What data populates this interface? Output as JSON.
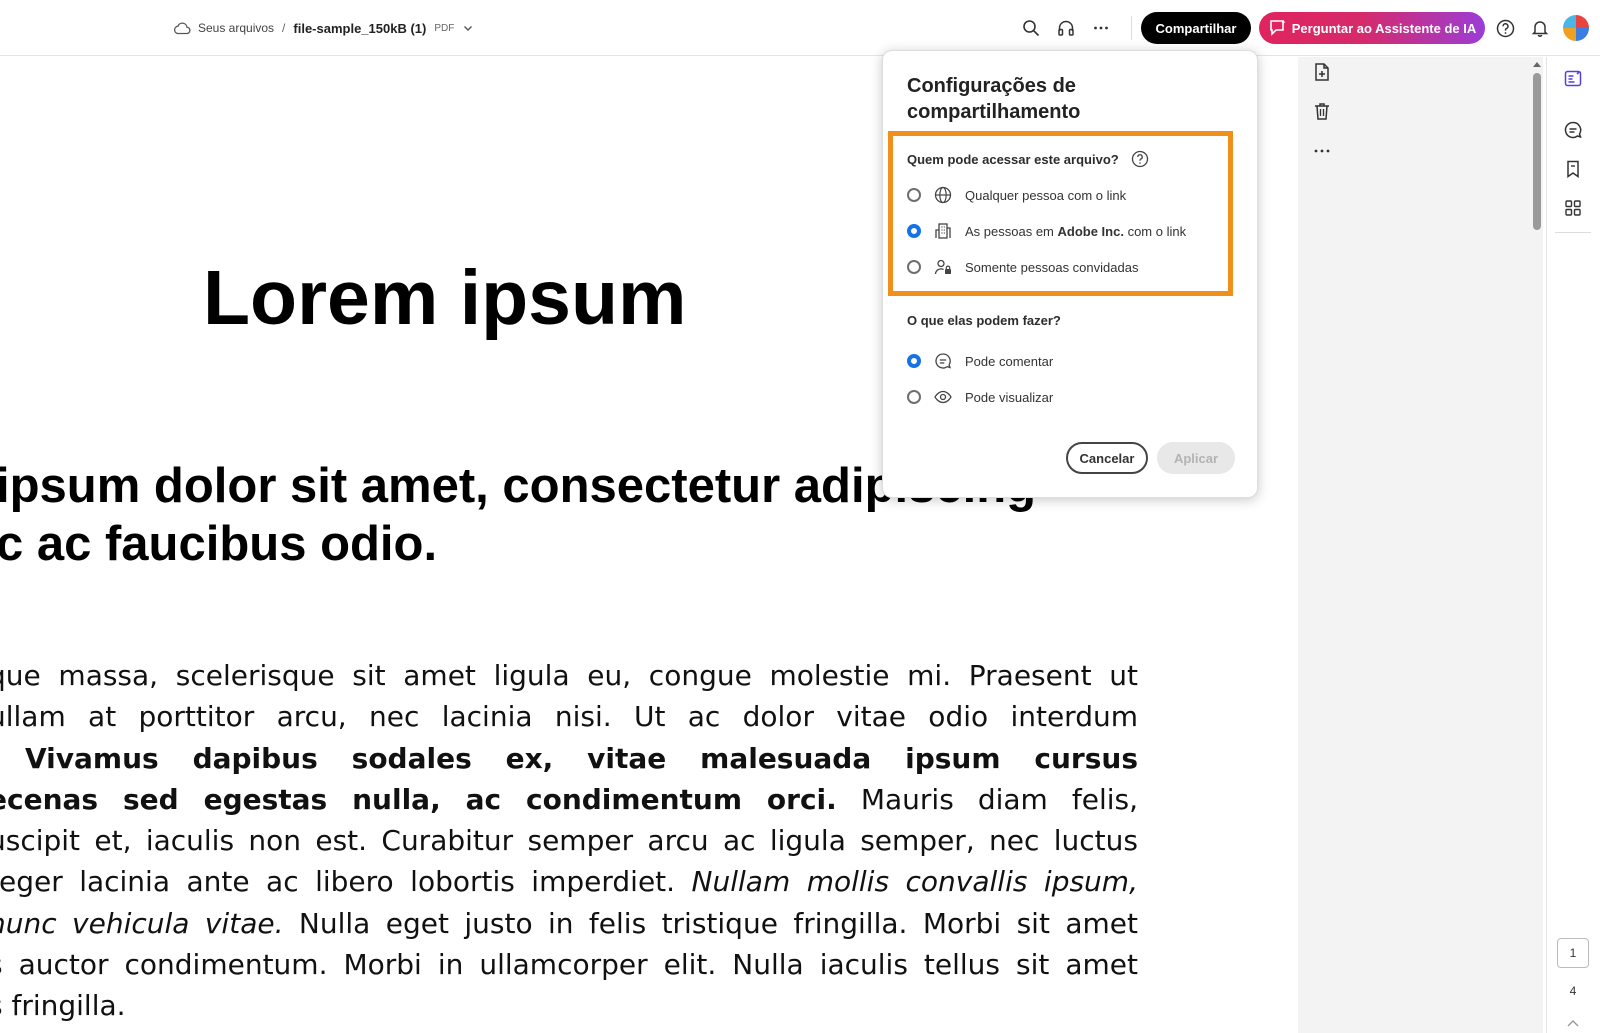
{
  "header": {
    "breadcrumb_root": "Seus arquivos",
    "breadcrumb_sep": "/",
    "file_name": "file-sample_150kB (1)",
    "file_type": "PDF",
    "share_label": "Compartilhar",
    "ai_label": "Perguntar ao Assistente de IA",
    "icons": [
      "search-icon",
      "headphones-icon",
      "more-icon",
      "help-icon",
      "bell-icon",
      "avatar"
    ]
  },
  "document": {
    "title": "Lorem ipsum",
    "heading_lines": [
      "ipsum dolor sit amet, consectetur adipiscing",
      "c ac faucibus odio."
    ],
    "paragraph": {
      "l1": "que massa, scelerisque sit amet ligula eu, congue molestie mi. Praesent ut",
      "l2": "ullam at porttitor arcu, nec lacinia nisi. Ut ac dolor vitae odio interdum",
      "l3_bold": "Vivamus dapibus sodales ex, vitae malesuada ipsum cursus",
      "l4_bold": "ecenas sed egestas nulla, ac condimentum orci.",
      "l4_rest": "Mauris diam felis,",
      "l5": "uscipit et, iaculis non est. Curabitur semper arcu ac ligula semper, nec luctus",
      "l6_start": "teger lacinia ante ac libero lobortis imperdiet.",
      "l6_italic": "Nullam mollis convallis ipsum,",
      "l7_italic": "nunc vehicula vitae.",
      "l7_rest": "Nulla eget justo in felis tristique fringilla. Morbi sit amet",
      "l8": "s auctor condimentum. Morbi in ullamcorper elit. Nulla iaculis tellus sit amet",
      "l9": "s fringilla."
    }
  },
  "share_dialog": {
    "title": "Configurações de compartilhamento",
    "access_question": "Quem pode acessar este arquivo?",
    "access_options": {
      "anyone": "Qualquer pessoa com o link",
      "org_prefix": "As pessoas em",
      "org_name": "Adobe Inc.",
      "org_suffix": "com o link",
      "invited": "Somente pessoas convidadas"
    },
    "access_selected": "org",
    "perm_question": "O que elas podem fazer?",
    "perm_options": {
      "comment": "Pode comentar",
      "view": "Pode visualizar"
    },
    "perm_selected": "comment",
    "cancel_label": "Cancelar",
    "apply_label": "Aplicar"
  },
  "pager": {
    "current": "1",
    "total": "4"
  },
  "colors": {
    "accent_blue": "#1473e6",
    "highlight_orange": "#f0901a",
    "ai_gradient_start": "#e0245e",
    "ai_gradient_end": "#9b3dd6"
  }
}
